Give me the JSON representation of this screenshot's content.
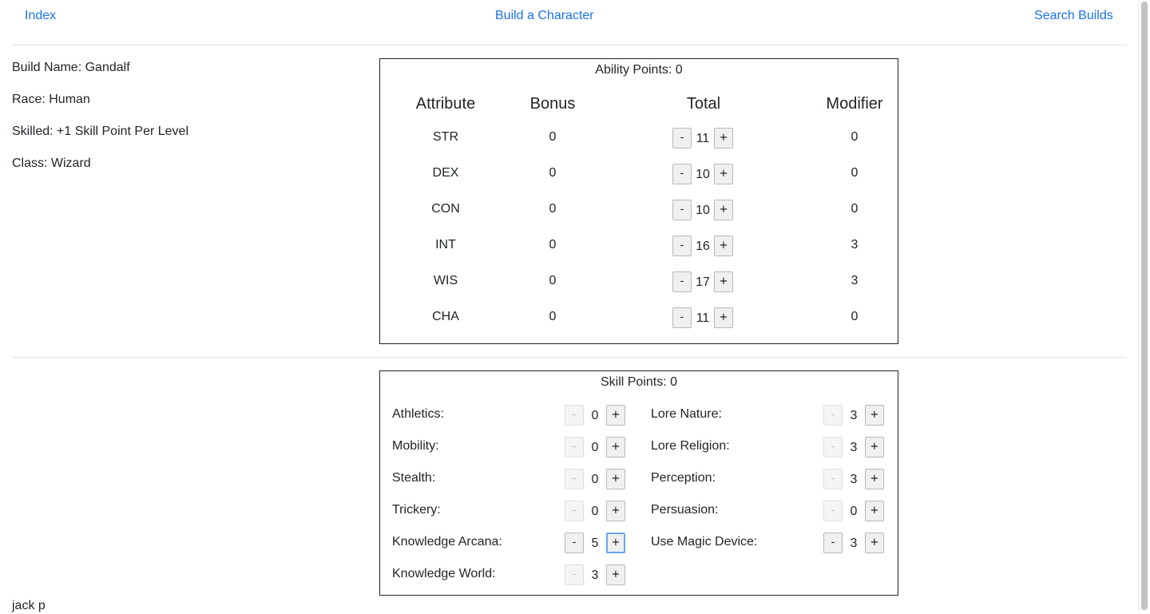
{
  "nav": {
    "index_label": "Index",
    "build_label": "Build a Character",
    "search_label": "Search Builds"
  },
  "info": {
    "build_name": "Build Name: Gandalf",
    "race": "Race: Human",
    "skilled": "Skilled: +1 Skill Point Per Level",
    "class": "Class: Wizard"
  },
  "ability": {
    "title": "Ability Points: 0",
    "headers": [
      "Attribute",
      "Bonus",
      "Total",
      "Modifier"
    ],
    "rows": [
      {
        "attr": "STR",
        "bonus": "0",
        "total": "11",
        "modifier": "0"
      },
      {
        "attr": "DEX",
        "bonus": "0",
        "total": "10",
        "modifier": "0"
      },
      {
        "attr": "CON",
        "bonus": "0",
        "total": "10",
        "modifier": "0"
      },
      {
        "attr": "INT",
        "bonus": "0",
        "total": "16",
        "modifier": "3"
      },
      {
        "attr": "WIS",
        "bonus": "0",
        "total": "17",
        "modifier": "3"
      },
      {
        "attr": "CHA",
        "bonus": "0",
        "total": "11",
        "modifier": "0"
      }
    ],
    "minus_label": "-",
    "plus_label": "+"
  },
  "skills": {
    "title": "Skill Points: 0",
    "minus_label": "-",
    "plus_label": "+",
    "left": [
      {
        "label": "Athletics:",
        "value": "0",
        "minus_enabled": false
      },
      {
        "label": "Mobility:",
        "value": "0",
        "minus_enabled": false
      },
      {
        "label": "Stealth:",
        "value": "0",
        "minus_enabled": false
      },
      {
        "label": "Trickery:",
        "value": "0",
        "minus_enabled": false
      },
      {
        "label": "Knowledge Arcana:",
        "value": "5",
        "minus_enabled": true,
        "plus_focused": true
      },
      {
        "label": "Knowledge World:",
        "value": "3",
        "minus_enabled": false
      }
    ],
    "right": [
      {
        "label": "Lore Nature:",
        "value": "3",
        "minus_enabled": false
      },
      {
        "label": "Lore Religion:",
        "value": "3",
        "minus_enabled": false
      },
      {
        "label": "Perception:",
        "value": "3",
        "minus_enabled": false
      },
      {
        "label": "Persuasion:",
        "value": "0",
        "minus_enabled": false
      },
      {
        "label": "Use Magic Device:",
        "value": "3",
        "minus_enabled": true
      }
    ]
  },
  "footer": {
    "text": "jack p"
  }
}
